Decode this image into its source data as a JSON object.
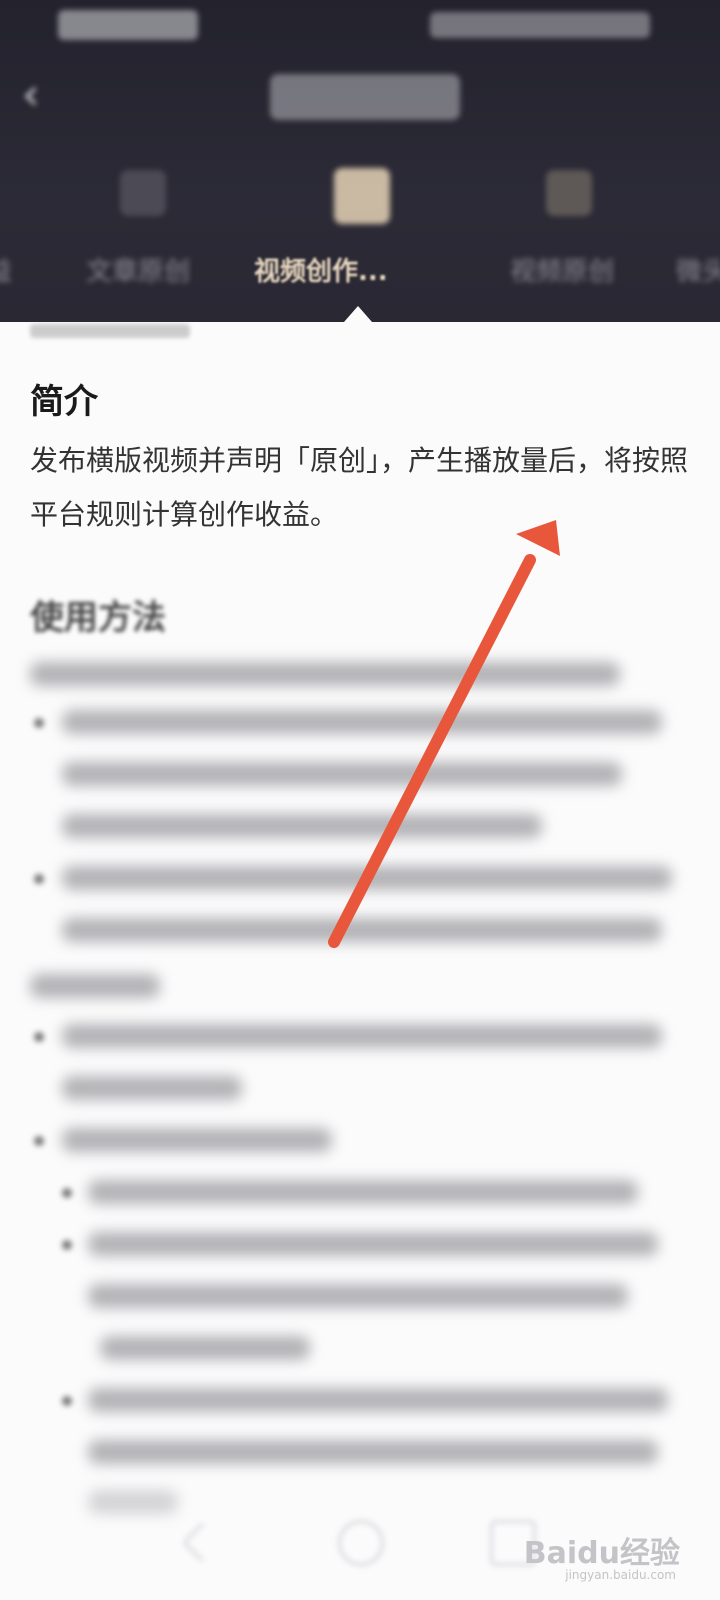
{
  "header": {
    "tabs": [
      {
        "label": "益"
      },
      {
        "label": "文章原创"
      },
      {
        "label": "视频创作..."
      },
      {
        "label": "视频原创"
      },
      {
        "label": "微头"
      }
    ]
  },
  "content": {
    "intro_heading": "简介",
    "intro_text": "发布横版视频并声明「原创」，产生播放量后，将按照平台规则计算创作收益。",
    "usage_heading": "使用方法"
  },
  "watermark": {
    "text": "Baidu经验",
    "sub": "jingyan.baidu.com"
  },
  "colors": {
    "header_bg": "#25242f",
    "active_tab": "#ead9c0",
    "arrow": "#e8573b"
  }
}
